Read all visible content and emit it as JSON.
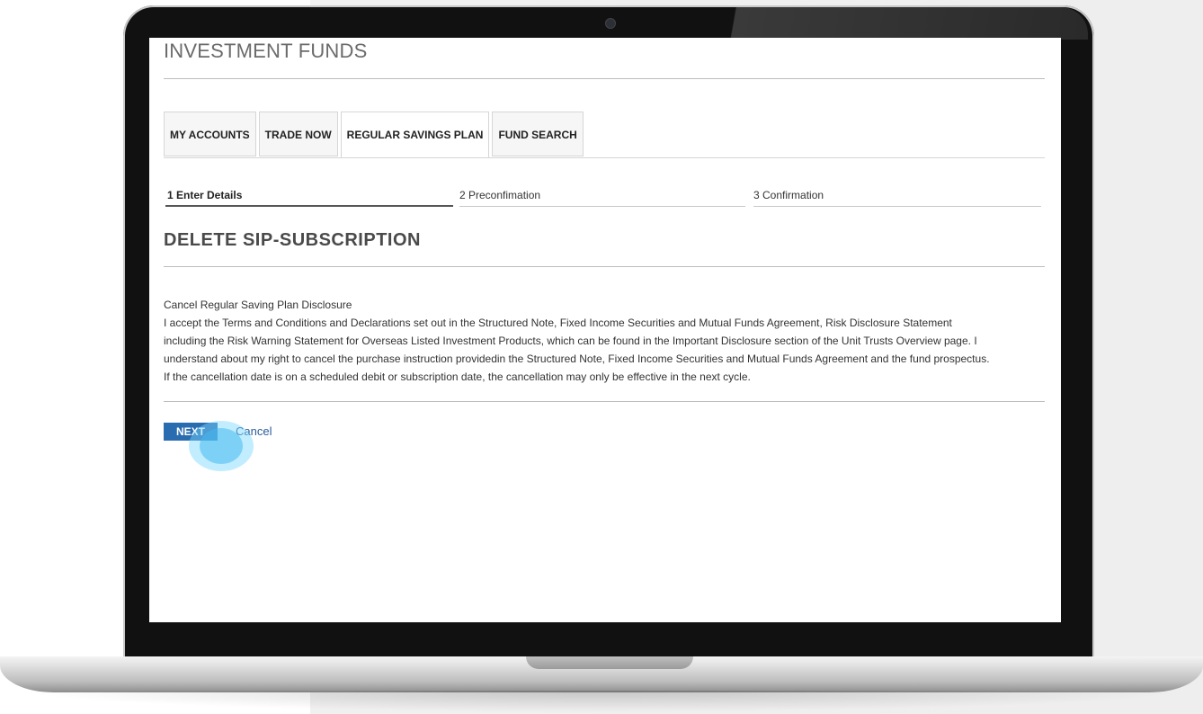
{
  "page": {
    "title": "INVESTMENT FUNDS"
  },
  "tabs": [
    {
      "label": "MY ACCOUNTS",
      "active": false
    },
    {
      "label": "TRADE NOW",
      "active": false
    },
    {
      "label": "REGULAR SAVINGS PLAN",
      "active": true
    },
    {
      "label": "FUND SEARCH",
      "active": false
    }
  ],
  "steps": [
    {
      "label": "1  Enter Details",
      "active": true
    },
    {
      "label": "2  Preconfimation",
      "active": false
    },
    {
      "label": "3  Confirmation",
      "active": false
    }
  ],
  "section": {
    "title": "DELETE SIP-SUBSCRIPTION"
  },
  "disclosure": {
    "heading": "Cancel Regular Saving Plan Disclosure",
    "lines": [
      "I accept the Terms and Conditions and Declarations set out in the Structured Note, Fixed Income Securities and Mutual Funds Agreement, Risk Disclosure Statement",
      "including the Risk Warning Statement for Overseas Listed Investment Products, which can be found in the Important Disclosure section of the Unit Trusts Overview page. I",
      "understand about my right to cancel the purchase instruction providedin the Structured Note, Fixed Income Securities and Mutual Funds Agreement and the fund prospectus.",
      "If the cancellation date is on a scheduled debit or subscription date, the cancellation may only be effective in the next cycle."
    ]
  },
  "actions": {
    "next_label": "NEXT",
    "cancel_label": "Cancel"
  },
  "colors": {
    "primary_button": "#2a6cb0",
    "link": "#2a5d9a",
    "tap_indicator": "#46b9f0"
  }
}
